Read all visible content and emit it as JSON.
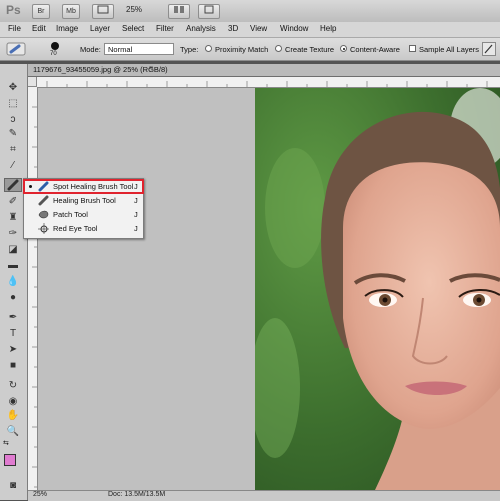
{
  "app": {
    "logo": "Ps",
    "bridge_label": "Br",
    "minibridge_label": "Mb",
    "zoom": "25%"
  },
  "menubar": [
    "File",
    "Edit",
    "Image",
    "Layer",
    "Select",
    "Filter",
    "Analysis",
    "3D",
    "View",
    "Window",
    "Help"
  ],
  "options": {
    "brush_size": "70",
    "mode_label": "Mode:",
    "mode_value": "Normal",
    "type_label": "Type:",
    "proximity_match": "Proximity Match",
    "create_texture": "Create Texture",
    "content_aware": "Content-Aware",
    "sample_all_layers": "Sample All Layers",
    "selected_type": "Content-Aware"
  },
  "document": {
    "tab_title": "1179676_93455059.jpg @ 25% (RGB/8)",
    "close_glyph": "×"
  },
  "status": {
    "zoom": "25%",
    "doc_info": "Doc: 13.5M/13.5M"
  },
  "flyout": {
    "items": [
      {
        "label": "Spot Healing Brush Tool",
        "key": "J",
        "selected": true
      },
      {
        "label": "Healing Brush Tool",
        "key": "J",
        "selected": false
      },
      {
        "label": "Patch Tool",
        "key": "J",
        "selected": false
      },
      {
        "label": "Red Eye Tool",
        "key": "J",
        "selected": false
      }
    ]
  },
  "colors": {
    "foreground": "#e07bd0",
    "background": "#ffffff",
    "highlight": "#e0232e"
  },
  "icons": {
    "tools": [
      "move-icon",
      "marquee-icon",
      "lasso-icon",
      "quick-select-icon",
      "crop-icon",
      "eyedropper-icon",
      "spot-healing-icon",
      "brush-icon",
      "clone-stamp-icon",
      "history-brush-icon",
      "eraser-icon",
      "gradient-icon",
      "blur-icon",
      "dodge-icon",
      "pen-icon",
      "type-icon",
      "path-select-icon",
      "shape-icon",
      "3d-rotate-icon",
      "3d-camera-icon",
      "hand-icon",
      "zoom-icon"
    ]
  }
}
